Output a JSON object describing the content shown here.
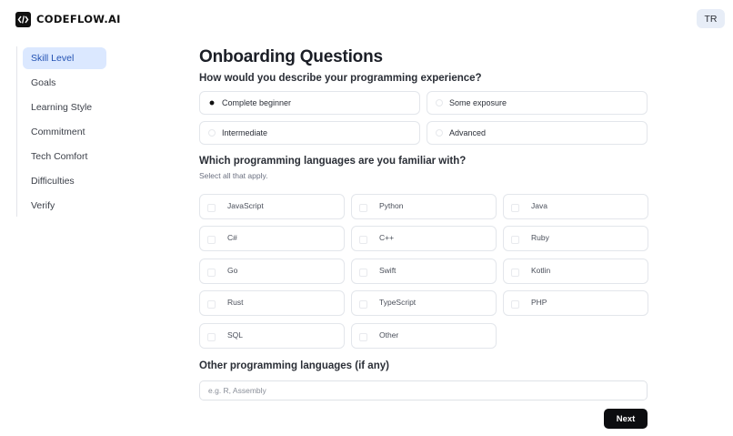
{
  "brand": {
    "name": "CODEFLOW.AI",
    "logo_icon": "code-slash-icon"
  },
  "user": {
    "initials": "TR"
  },
  "sidebar": {
    "items": [
      {
        "label": "Skill Level",
        "active": true
      },
      {
        "label": "Goals",
        "active": false
      },
      {
        "label": "Learning Style",
        "active": false
      },
      {
        "label": "Commitment",
        "active": false
      },
      {
        "label": "Tech Comfort",
        "active": false
      },
      {
        "label": "Difficulties",
        "active": false
      },
      {
        "label": "Verify",
        "active": false
      }
    ]
  },
  "main": {
    "title": "Onboarding Questions",
    "experience": {
      "question": "How would you describe your programming experience?",
      "options": [
        {
          "label": "Complete beginner",
          "selected": true
        },
        {
          "label": "Some exposure",
          "selected": false
        },
        {
          "label": "Intermediate",
          "selected": false
        },
        {
          "label": "Advanced",
          "selected": false
        }
      ]
    },
    "languages": {
      "question": "Which programming languages are you familiar with?",
      "hint": "Select all that apply.",
      "options": [
        {
          "label": "JavaScript",
          "checked": false
        },
        {
          "label": "Python",
          "checked": false
        },
        {
          "label": "Java",
          "checked": false
        },
        {
          "label": "C#",
          "checked": false
        },
        {
          "label": "C++",
          "checked": false
        },
        {
          "label": "Ruby",
          "checked": false
        },
        {
          "label": "Go",
          "checked": false
        },
        {
          "label": "Swift",
          "checked": false
        },
        {
          "label": "Kotlin",
          "checked": false
        },
        {
          "label": "Rust",
          "checked": false
        },
        {
          "label": "TypeScript",
          "checked": false
        },
        {
          "label": "PHP",
          "checked": false
        },
        {
          "label": "SQL",
          "checked": false
        },
        {
          "label": "Other",
          "checked": false
        }
      ]
    },
    "other_languages": {
      "question": "Other programming languages (if any)",
      "value": "",
      "placeholder": "e.g. R, Assembly"
    },
    "next_label": "Next"
  },
  "colors": {
    "active_nav_bg": "#dbe8ff",
    "active_nav_text": "#2352b3",
    "primary_button": "#0c0d10"
  }
}
